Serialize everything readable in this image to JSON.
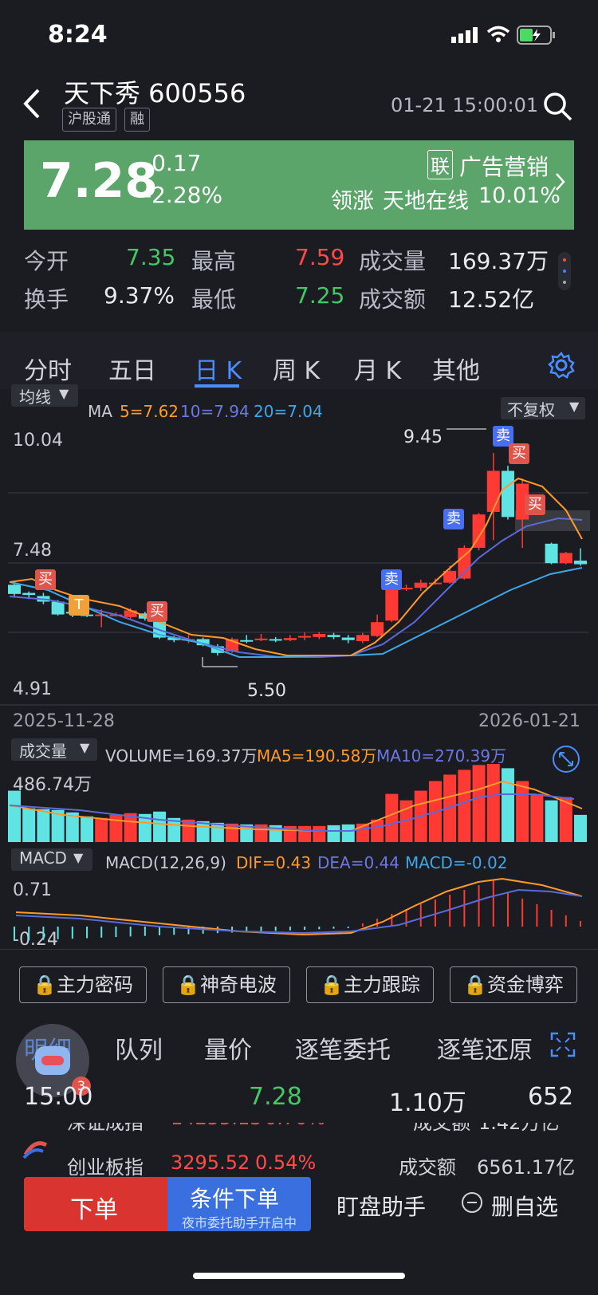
{
  "status": {
    "time": "8:24"
  },
  "header": {
    "title": "天下秀 600556",
    "tags": [
      "沪股通",
      "融"
    ],
    "datetime": "01-21 15:00:01"
  },
  "quote": {
    "price": "7.28",
    "change": "-0.17",
    "change_pct": "-2.28%",
    "sector_tag": "联",
    "sector": "广告营销",
    "leader_label": "领涨",
    "leader_name": "天地在线",
    "leader_pct": "10.01%"
  },
  "stats": {
    "open_label": "今开",
    "open": "7.35",
    "high_label": "最高",
    "high": "7.59",
    "vol_label": "成交量",
    "vol": "169.37万",
    "turnover_label": "换手",
    "turnover": "9.37%",
    "low_label": "最低",
    "low": "7.25",
    "amount_label": "成交额",
    "amount": "12.52亿"
  },
  "tabs": [
    "分时",
    "五日",
    "日 K",
    "周 K",
    "月 K",
    "其他"
  ],
  "kline": {
    "ma_button": "均线",
    "ma_label": "MA",
    "ma5": "5=7.62",
    "ma10": "10=7.94",
    "ma20": "20=7.04",
    "adjust": "不复权",
    "y_top": "10.04",
    "y_mid": "7.48",
    "y_bottom": "4.91",
    "high_marker": "9.45",
    "low_marker": "5.50",
    "date_start": "2025-11-28",
    "date_end": "2026-01-21",
    "buy": "买",
    "sell": "卖",
    "t": "T"
  },
  "volume": {
    "button": "成交量",
    "label": "VOLUME=169.37万",
    "ma5": "MA5=190.58万",
    "ma10": "MA10=270.39万",
    "y_top": "486.74万"
  },
  "macd": {
    "button": "MACD",
    "label": "MACD(12,26,9)",
    "dif": "DIF=0.43",
    "dea": "DEA=0.44",
    "macd": "MACD=-0.02",
    "y_top": "0.71",
    "y_bottom": "-0.24"
  },
  "locked": [
    "主力密码",
    "神奇电波",
    "主力跟踪",
    "资金博弈"
  ],
  "detail_tabs": [
    "明细",
    "队列",
    "量价",
    "逐笔委托",
    "逐笔还原"
  ],
  "detail_row": {
    "time": "15:00",
    "price": "7.28",
    "volume": "1.10万",
    "count": "652"
  },
  "badge": "3",
  "index_row1": {
    "name": "深证成指",
    "value": "14255.13",
    "pct": "0.70%",
    "lbl": "成交额",
    "amt": "1.42万亿"
  },
  "index_row2": {
    "name": "创业板指",
    "value": "3295.52",
    "pct": "0.54%",
    "lbl": "成交额",
    "amt": "6561.17亿"
  },
  "actions": {
    "order": "下单",
    "cond_order": "条件下单",
    "cond_sub": "夜市委托助手开启中",
    "assist": "盯盘助手",
    "remove": "删自选"
  },
  "chart_data": {
    "type": "candlestick",
    "title": "",
    "ylim": [
      4.91,
      10.04
    ],
    "x_range": [
      "2025-11-28",
      "2026-01-21"
    ],
    "candles": [
      {
        "o": 6.88,
        "c": 6.7,
        "h": 6.95,
        "l": 6.66
      },
      {
        "o": 6.72,
        "c": 6.68,
        "h": 6.75,
        "l": 6.6
      },
      {
        "o": 6.66,
        "c": 6.55,
        "h": 6.72,
        "l": 6.5
      },
      {
        "o": 6.55,
        "c": 6.3,
        "h": 6.58,
        "l": 6.28
      },
      {
        "o": 6.35,
        "c": 6.33,
        "h": 6.45,
        "l": 6.25
      },
      {
        "o": 6.3,
        "c": 6.28,
        "h": 6.35,
        "l": 6.25
      },
      {
        "o": 6.28,
        "c": 6.3,
        "h": 6.4,
        "l": 6.05
      },
      {
        "o": 6.3,
        "c": 6.3,
        "h": 6.34,
        "l": 6.26
      },
      {
        "o": 6.25,
        "c": 6.38,
        "h": 6.42,
        "l": 6.2
      },
      {
        "o": 6.32,
        "c": 6.22,
        "h": 6.35,
        "l": 6.18
      },
      {
        "o": 6.25,
        "c": 5.85,
        "h": 6.28,
        "l": 5.82
      },
      {
        "o": 5.85,
        "c": 5.8,
        "h": 5.88,
        "l": 5.76
      },
      {
        "o": 5.8,
        "c": 5.82,
        "h": 5.9,
        "l": 5.74
      },
      {
        "o": 5.82,
        "c": 5.7,
        "h": 5.85,
        "l": 5.68
      },
      {
        "o": 5.68,
        "c": 5.55,
        "h": 5.72,
        "l": 5.5
      },
      {
        "o": 5.58,
        "c": 5.82,
        "h": 5.85,
        "l": 5.55
      },
      {
        "o": 5.8,
        "c": 5.78,
        "h": 5.9,
        "l": 5.74
      },
      {
        "o": 5.8,
        "c": 5.83,
        "h": 5.92,
        "l": 5.78
      },
      {
        "o": 5.82,
        "c": 5.8,
        "h": 5.86,
        "l": 5.76
      },
      {
        "o": 5.8,
        "c": 5.84,
        "h": 5.9,
        "l": 5.78
      },
      {
        "o": 5.86,
        "c": 5.88,
        "h": 5.95,
        "l": 5.8
      },
      {
        "o": 5.86,
        "c": 5.92,
        "h": 5.96,
        "l": 5.82
      },
      {
        "o": 5.9,
        "c": 5.86,
        "h": 5.94,
        "l": 5.82
      },
      {
        "o": 5.85,
        "c": 5.8,
        "h": 5.9,
        "l": 5.74
      },
      {
        "o": 5.78,
        "c": 5.9,
        "h": 5.94,
        "l": 5.74
      },
      {
        "o": 5.88,
        "c": 6.15,
        "h": 6.3,
        "l": 5.86
      },
      {
        "o": 6.18,
        "c": 6.8,
        "h": 6.85,
        "l": 6.15
      },
      {
        "o": 6.82,
        "c": 6.82,
        "h": 6.88,
        "l": 6.76
      },
      {
        "o": 6.82,
        "c": 6.92,
        "h": 6.98,
        "l": 6.76
      },
      {
        "o": 6.92,
        "c": 6.92,
        "h": 7.0,
        "l": 6.88
      },
      {
        "o": 6.92,
        "c": 7.15,
        "h": 7.25,
        "l": 6.9
      },
      {
        "o": 7.0,
        "c": 7.6,
        "h": 7.65,
        "l": 6.98
      },
      {
        "o": 7.6,
        "c": 8.25,
        "h": 8.28,
        "l": 7.55
      },
      {
        "o": 8.3,
        "c": 9.1,
        "h": 9.45,
        "l": 7.75
      },
      {
        "o": 9.1,
        "c": 8.2,
        "h": 9.2,
        "l": 8.15
      },
      {
        "o": 8.15,
        "c": 8.85,
        "h": 8.95,
        "l": 7.6
      },
      {
        "o": 8.35,
        "c": 8.36,
        "h": 8.38,
        "l": 8.32
      },
      {
        "o": 7.68,
        "c": 7.3,
        "h": 7.7,
        "l": 7.28
      },
      {
        "o": 7.3,
        "c": 7.5,
        "h": 7.52,
        "l": 7.28
      },
      {
        "o": 7.35,
        "c": 7.28,
        "h": 7.59,
        "l": 7.25
      }
    ],
    "volumes": [
      320,
      210,
      205,
      200,
      185,
      160,
      150,
      170,
      180,
      175,
      190,
      150,
      140,
      130,
      120,
      115,
      110,
      110,
      105,
      100,
      100,
      100,
      105,
      110,
      115,
      140,
      300,
      260,
      320,
      380,
      420,
      450,
      480,
      486.74,
      460,
      380,
      300,
      260,
      280,
      169.37
    ]
  }
}
